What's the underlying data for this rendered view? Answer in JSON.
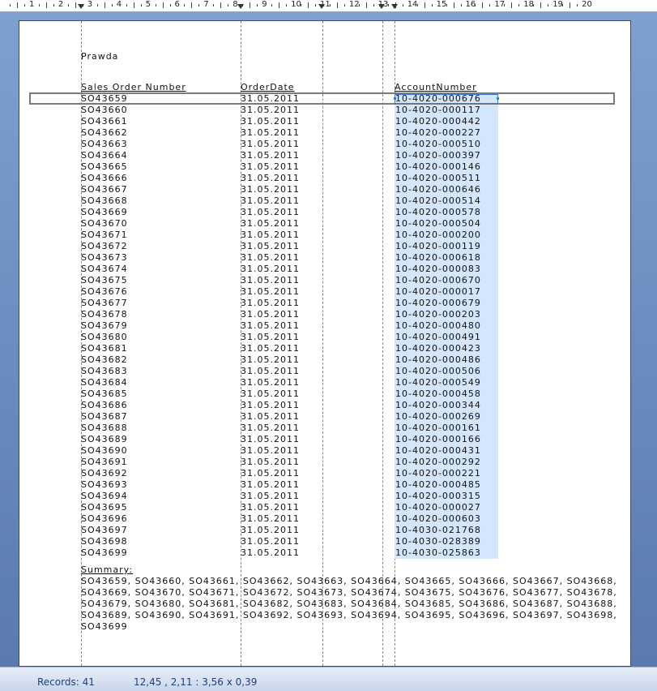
{
  "ruler": {
    "numbers": [
      "1",
      "2",
      "3",
      "4",
      "5",
      "6",
      "7",
      "8",
      "9",
      "10",
      "11",
      "12",
      "13",
      "14",
      "15",
      "16",
      "17",
      "18",
      "19",
      "20"
    ]
  },
  "report": {
    "title": "Prawda",
    "headers": {
      "sales_order": "Sales Order Number",
      "order_date": "OrderDate",
      "account": "AccountNumber"
    },
    "rows": [
      {
        "so": "SO43659",
        "date": "31.05.2011",
        "acct": "10-4020-000676"
      },
      {
        "so": "SO43660",
        "date": "31.05.2011",
        "acct": "10-4020-000117"
      },
      {
        "so": "SO43661",
        "date": "31.05.2011",
        "acct": "10-4020-000442"
      },
      {
        "so": "SO43662",
        "date": "31.05.2011",
        "acct": "10-4020-000227"
      },
      {
        "so": "SO43663",
        "date": "31.05.2011",
        "acct": "10-4020-000510"
      },
      {
        "so": "SO43664",
        "date": "31.05.2011",
        "acct": "10-4020-000397"
      },
      {
        "so": "SO43665",
        "date": "31.05.2011",
        "acct": "10-4020-000146"
      },
      {
        "so": "SO43666",
        "date": "31.05.2011",
        "acct": "10-4020-000511"
      },
      {
        "so": "SO43667",
        "date": "31.05.2011",
        "acct": "10-4020-000646"
      },
      {
        "so": "SO43668",
        "date": "31.05.2011",
        "acct": "10-4020-000514"
      },
      {
        "so": "SO43669",
        "date": "31.05.2011",
        "acct": "10-4020-000578"
      },
      {
        "so": "SO43670",
        "date": "31.05.2011",
        "acct": "10-4020-000504"
      },
      {
        "so": "SO43671",
        "date": "31.05.2011",
        "acct": "10-4020-000200"
      },
      {
        "so": "SO43672",
        "date": "31.05.2011",
        "acct": "10-4020-000119"
      },
      {
        "so": "SO43673",
        "date": "31.05.2011",
        "acct": "10-4020-000618"
      },
      {
        "so": "SO43674",
        "date": "31.05.2011",
        "acct": "10-4020-000083"
      },
      {
        "so": "SO43675",
        "date": "31.05.2011",
        "acct": "10-4020-000670"
      },
      {
        "so": "SO43676",
        "date": "31.05.2011",
        "acct": "10-4020-000017"
      },
      {
        "so": "SO43677",
        "date": "31.05.2011",
        "acct": "10-4020-000679"
      },
      {
        "so": "SO43678",
        "date": "31.05.2011",
        "acct": "10-4020-000203"
      },
      {
        "so": "SO43679",
        "date": "31.05.2011",
        "acct": "10-4020-000480"
      },
      {
        "so": "SO43680",
        "date": "31.05.2011",
        "acct": "10-4020-000491"
      },
      {
        "so": "SO43681",
        "date": "31.05.2011",
        "acct": "10-4020-000423"
      },
      {
        "so": "SO43682",
        "date": "31.05.2011",
        "acct": "10-4020-000486"
      },
      {
        "so": "SO43683",
        "date": "31.05.2011",
        "acct": "10-4020-000506"
      },
      {
        "so": "SO43684",
        "date": "31.05.2011",
        "acct": "10-4020-000549"
      },
      {
        "so": "SO43685",
        "date": "31.05.2011",
        "acct": "10-4020-000458"
      },
      {
        "so": "SO43686",
        "date": "31.05.2011",
        "acct": "10-4020-000344"
      },
      {
        "so": "SO43687",
        "date": "31.05.2011",
        "acct": "10-4020-000269"
      },
      {
        "so": "SO43688",
        "date": "31.05.2011",
        "acct": "10-4020-000161"
      },
      {
        "so": "SO43689",
        "date": "31.05.2011",
        "acct": "10-4020-000166"
      },
      {
        "so": "SO43690",
        "date": "31.05.2011",
        "acct": "10-4020-000431"
      },
      {
        "so": "SO43691",
        "date": "31.05.2011",
        "acct": "10-4020-000292"
      },
      {
        "so": "SO43692",
        "date": "31.05.2011",
        "acct": "10-4020-000221"
      },
      {
        "so": "SO43693",
        "date": "31.05.2011",
        "acct": "10-4020-000485"
      },
      {
        "so": "SO43694",
        "date": "31.05.2011",
        "acct": "10-4020-000315"
      },
      {
        "so": "SO43695",
        "date": "31.05.2011",
        "acct": "10-4020-000027"
      },
      {
        "so": "SO43696",
        "date": "31.05.2011",
        "acct": "10-4020-000603"
      },
      {
        "so": "SO43697",
        "date": "31.05.2011",
        "acct": "10-4030-021768"
      },
      {
        "so": "SO43698",
        "date": "31.05.2011",
        "acct": "10-4030-028389"
      },
      {
        "so": "SO43699",
        "date": "31.05.2011",
        "acct": "10-4030-025863"
      }
    ],
    "summary_label": "Summary:",
    "summary_lines": [
      "SO43659, SO43660, SO43661, SO43662, SO43663, SO43664, SO43665, SO43666, SO43667, SO43668,",
      "SO43669, SO43670, SO43671, SO43672, SO43673, SO43674, SO43675, SO43676, SO43677, SO43678,",
      "SO43679, SO43680, SO43681, SO43682, SO43683, SO43684, SO43685, SO43686, SO43687, SO43688,",
      "SO43689, SO43690, SO43691, SO43692, SO43693, SO43694, SO43695, SO43696, SO43697, SO43698,",
      "SO43699"
    ]
  },
  "status": {
    "records": "Records:  41",
    "coords": "12,45 , 2,11 : 3,56 x 0,39"
  },
  "colors": {
    "selection": "#d3e6fb",
    "workspace": "#6f8fbd"
  }
}
